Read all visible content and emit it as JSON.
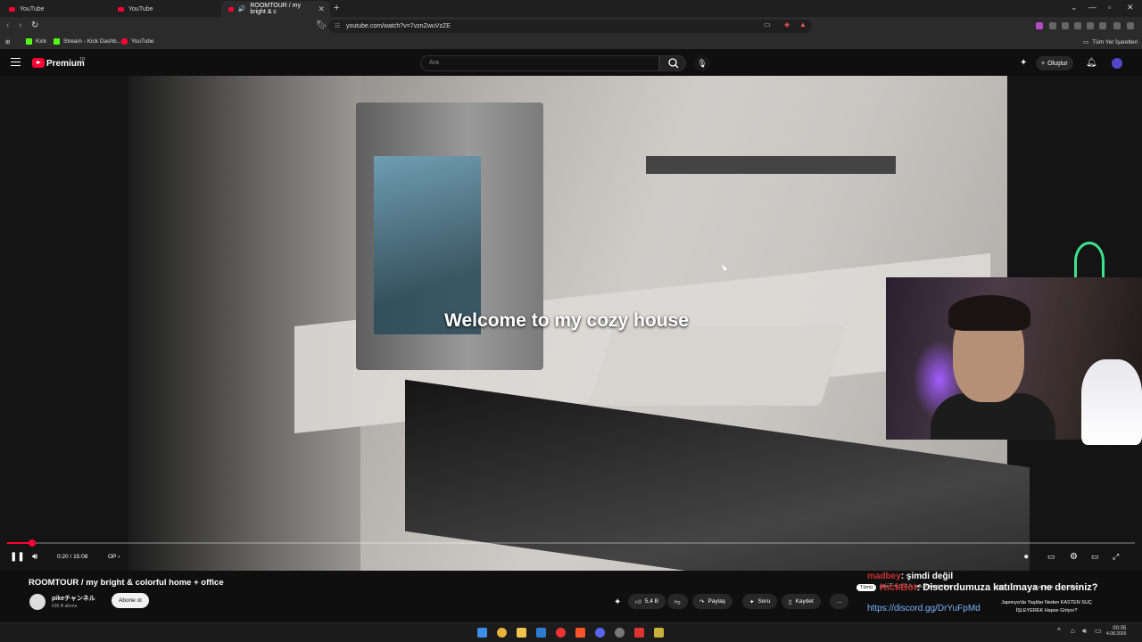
{
  "browser": {
    "tabs": [
      {
        "label": "YouTube",
        "active": false
      },
      {
        "label": "YouTube",
        "active": false
      },
      {
        "label": "ROOMTOUR / my bright & c",
        "active": true
      }
    ],
    "new_tab": "+",
    "url": "youtube.com/watch?v=7vznZwuVzZE",
    "bookmarks": [
      "Kick",
      "Stream - Kick Dashb...",
      "YouTube"
    ],
    "all_bookmarks": "Tüm Yer İşaretleri"
  },
  "youtube": {
    "brand": "Premium",
    "region": "TR",
    "search_placeholder": "Ara",
    "create_label": "Oluştur"
  },
  "video": {
    "overlay_text": "Welcome to my cozy house",
    "time": "0:20 / 15:08",
    "chapter": "OP",
    "progress": 0.022
  },
  "meta": {
    "title": "ROOMTOUR / my bright & colorful home + office",
    "channel": "pikeチャンネル",
    "subscribers": "636 B abone",
    "subscribe_label": "Abone ol",
    "likes": "5,4 B",
    "share": "Paylaş",
    "ask": "Soru",
    "save": "Kaydet",
    "more": "..."
  },
  "stream_chat": {
    "line1_name": "madbey",
    "line1_text": ": şimdi değil",
    "line2_name": "KickBot",
    "line2_text": ": Discordumuza katılmaya ne dersiniz?",
    "line3_text": "https://discord.gg/DrYuFpMd",
    "sub_text": "pikeチャンネル adlı yükleyiciden",
    "tabs": [
      "Tümü",
      "İlgili",
      "Size özel",
      "Son y"
    ],
    "news": "Japonya'da Yaşlılar Neden KASTEN SUÇ İŞLEYEREK Hapse Giriyor?"
  },
  "taskbar": {
    "time": "00:05",
    "date": "4.08.2026"
  },
  "colors": {
    "accent": "#ff0033",
    "background": "#0f0f0f",
    "chat_name": "#c93030",
    "chat_link": "#7fb2ff"
  }
}
